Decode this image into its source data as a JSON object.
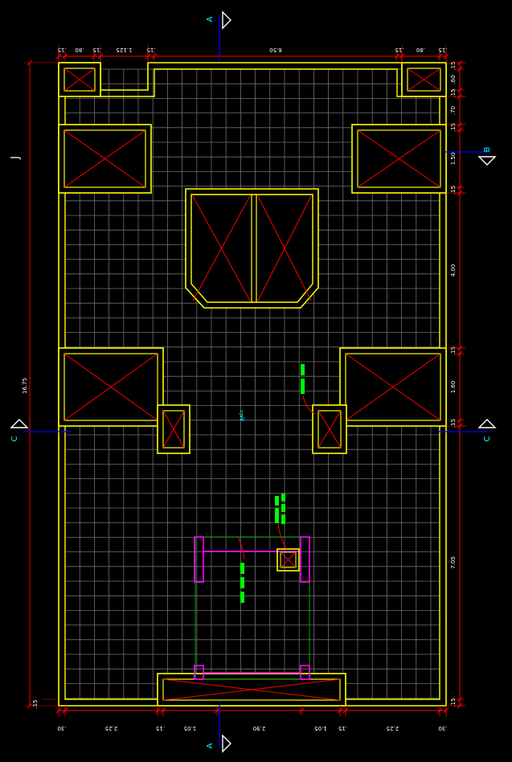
{
  "colors": {
    "background": "#000000",
    "grid": "#7f7f7f",
    "wall": "#ffff00",
    "cross": "#ff0000",
    "dimension": "#ff0000",
    "dimension_text": "#ffffff",
    "section_line": "#0000ff",
    "section_label": "#00ffff",
    "marker": "#00ff00",
    "equipment": "#ff00ff",
    "pathway": "#00aa00"
  },
  "section_markers": {
    "top": "A",
    "bottom": "A",
    "right_upper": "B",
    "left_mid": "C",
    "right_mid": "C",
    "left_upper": "J"
  },
  "floor_tile_label": "دئعع",
  "top_dimensions": [
    ".15",
    ".80",
    ".15",
    "1.125",
    ".15",
    "6.50",
    ".15",
    ".80",
    ".15"
  ],
  "bottom_dimensions": [
    ".30",
    "2.25",
    ".15",
    "1.05",
    "2.90",
    "1.05",
    ".15",
    "2.25",
    ".30"
  ],
  "left_dimensions": [
    "16.75",
    ".15"
  ],
  "right_dimensions": [
    ".15",
    ".60",
    ".15",
    ".70",
    ".15",
    "1.50",
    ".15",
    "4.00",
    ".15",
    "1.60",
    ".15",
    "7.05",
    ".15"
  ]
}
